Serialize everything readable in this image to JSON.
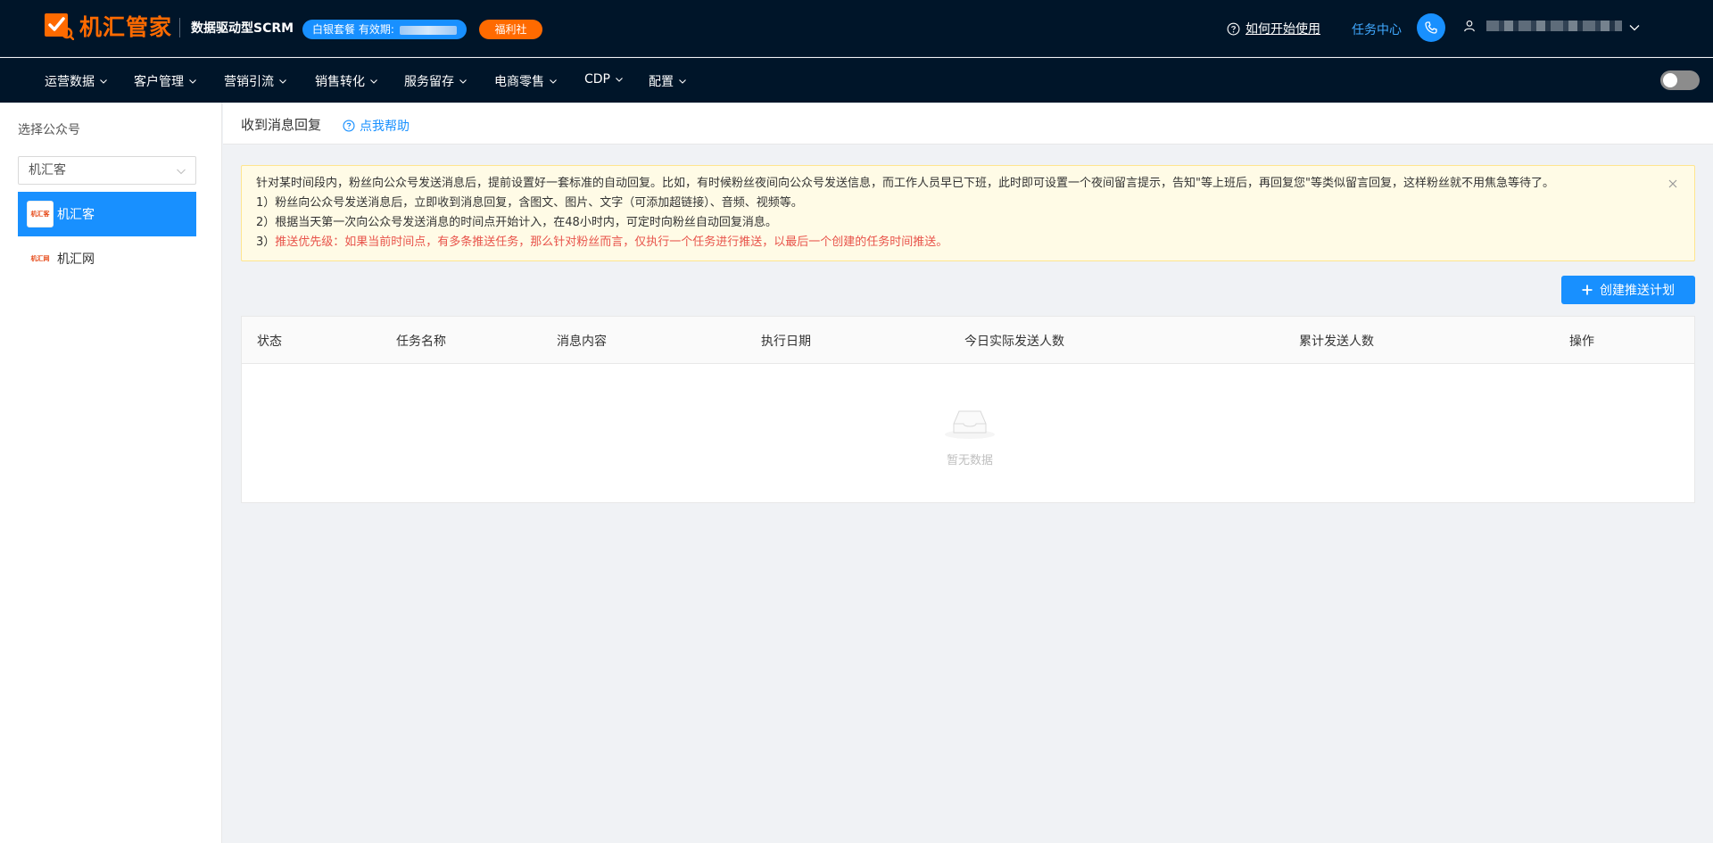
{
  "header": {
    "brand": "机汇管家",
    "tagline": "数据驱动型SCRM",
    "plan_label": "白银套餐 有效期:",
    "welfare_label": "福利社",
    "help_label": "如何开始使用",
    "task_center": "任务中心"
  },
  "nav": {
    "items": [
      "运营数据",
      "客户管理",
      "营销引流",
      "销售转化",
      "服务留存",
      "电商零售",
      "CDP",
      "配置"
    ]
  },
  "sidebar": {
    "title": "选择公众号",
    "select_value": "机汇客",
    "accounts": [
      {
        "name": "机汇客",
        "logo_text": "机汇客"
      },
      {
        "name": "机汇网",
        "logo_text": "机汇网"
      }
    ]
  },
  "main": {
    "page_title": "收到消息回复",
    "help_button": "点我帮助",
    "alert": {
      "line1": "针对某时间段内，粉丝向公众号发送消息后，提前设置好一套标准的自动回复。比如，有时候粉丝夜间向公众号发送信息，而工作人员早已下班，此时即可设置一个夜间留言提示，告知\"等上班后，再回复您\"等类似留言回复，这样粉丝就不用焦急等待了。",
      "line2": "1）粉丝向公众号发送消息后，立即收到消息回复，含图文、图片、文字（可添加超链接）、音频、视频等。",
      "line3": "2）根据当天第一次向公众号发送消息的时间点开始计入，在48小时内，可定时向粉丝自动回复消息。",
      "line4_prefix": "3）",
      "line4": "推送优先级：如果当前时间点，有多条推送任务，那么针对粉丝而言，仅执行一个任务进行推送，以最后一个创建的任务时间推送。"
    },
    "create_button": "创建推送计划",
    "table": {
      "columns": [
        "状态",
        "任务名称",
        "消息内容",
        "执行日期",
        "今日实际发送人数",
        "累计发送人数",
        "操作"
      ],
      "empty_text": "暂无数据"
    }
  },
  "colors": {
    "header_bg": "#001529",
    "brand_orange": "#ff6a00",
    "primary_blue": "#1890ff",
    "alert_bg": "#fffbe6",
    "alert_red": "#e8534a"
  }
}
